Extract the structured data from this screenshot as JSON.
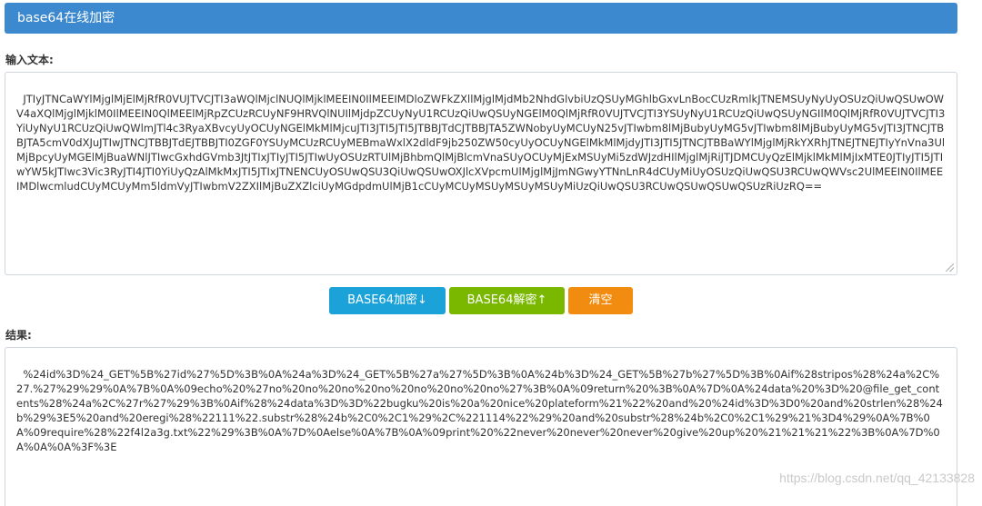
{
  "header": {
    "title": "base64在线加密"
  },
  "input": {
    "label": "输入文本:",
    "value": "JTIyJTNCaWYlMjglMjElMjRfR0VUJTVCJTI3aWQlMjclNUQlMjklMEEIN0IlMEEIMDloZWFkZXllMjglMjdMb2NhdGlvbiUzQSUyMGhlbGxvLnBocCUzRmlkJTNEMSUyNyUyOSUzQiUwQSUwOWV4aXQlMjglMjklM0IlMEEIN0QlMEElMjRpZCUzRCUyNF9HRVQlNUIlMjdpZCUyNyU1RCUzQiUwQSUyNGElM0QlMjRfR0VUJTVCJTI3YSUyNyU1RCUzQiUwQSUyNGIlM0QlMjRfR0VUJTVCJTI3YiUyNyU1RCUzQiUwQWlmJTl4c3RyaXBvcyUyOCUyNGElMkMlMjcuJTI3JTI5JTI5JTBBJTdCJTBBJTA5ZWNobyUyMCUyN25vJTIwbm8lMjBubyUyMG5vJTIwbm8lMjBubyUyMG5vJTI3JTNCJTBBJTA5cmV0dXJuJTIwJTNCJTBBJTdEJTBBJTI0ZGF0YSUyMCUzRCUyMEBmaWxlX2dldF9jb250ZW50cyUyOCUyNGElMkMlMjdyJTI3JTI5JTNCJTBBaWYlMjglMjRkYXRhJTNEJTNEJTIyYnVna3UlMjBpcyUyMGElMjBuaWNlJTIwcGxhdGVmb3JtJTIxJTIyJTI5JTIwUyOSUzRTUlMjBhbmQlMjBlcmVnaSUyOCUyMjExMSUyMi5zdWJzdHIlMjglMjRiJTJDMCUyQzElMjklMkMlMjIxMTE0JTIyJTI5JTIwYW5kJTIwc3Vic3RyJTI4JTI0YiUyQzAlMkMxJTI5JTIxJTNENCUyOSUwQSU3QiUwQSUwOXJlcXVpcmUlMjglMjJmNGwyYTNnLnR4dCUyMiUyOSUzQiUwQSU3RCUwQWVsc2UlMEEIN0IlMEEIMDlwcmludCUyMCUyMm5ldmVyJTIwbmV2ZXIlMjBuZXZlciUyMGdpdmUlMjB1cCUyMCUyMSUyMSUyMSUyMiUzQiUwQSU3RCUwQSUwQSUwQSUzRiUzRQ==",
    "resize_handle": "resize-grip-icon"
  },
  "buttons": {
    "encode": {
      "label": "BASE64加密↓",
      "color": "#1aa2d9"
    },
    "decode": {
      "label": "BASE64解密↑",
      "color": "#7ab800"
    },
    "clear": {
      "label": "清空",
      "color": "#f28c10"
    }
  },
  "result": {
    "label": "结果:",
    "value": "%24id%3D%24_GET%5B%27id%27%5D%3B%0A%24a%3D%24_GET%5B%27a%27%5D%3B%0A%24b%3D%24_GET%5B%27b%27%5D%3B%0Aif%28stripos%28%24a%2C%27.%27%29%29%0A%7B%0A%09echo%20%27no%20no%20no%20no%20no%20no%20no%27%3B%0A%09return%20%3B%0A%7D%0A%24data%20%3D%20@file_get_contents%28%24a%2C%27r%27%29%3B%0Aif%28%24data%3D%3D%22bugku%20is%20a%20nice%20plateform%21%22%20and%20%24id%3D%3D0%20and%20strlen%28%24b%29%3E5%20and%20eregi%28%22111%22.substr%28%24b%2C0%2C1%29%2C%221114%22%29%20and%20substr%28%24b%2C0%2C1%29%21%3D4%29%0A%7B%0A%09require%28%22f4l2a3g.txt%22%29%3B%0A%7D%0Aelse%0A%7B%0A%09print%20%22never%20never%20never%20give%20up%20%21%21%21%22%3B%0A%7D%0A%0A%0A%3F%3E"
  },
  "watermark": "https://blog.csdn.net/qq_42133828",
  "colors": {
    "header_bg": "#3c89d0",
    "border": "#cfd6dd"
  }
}
